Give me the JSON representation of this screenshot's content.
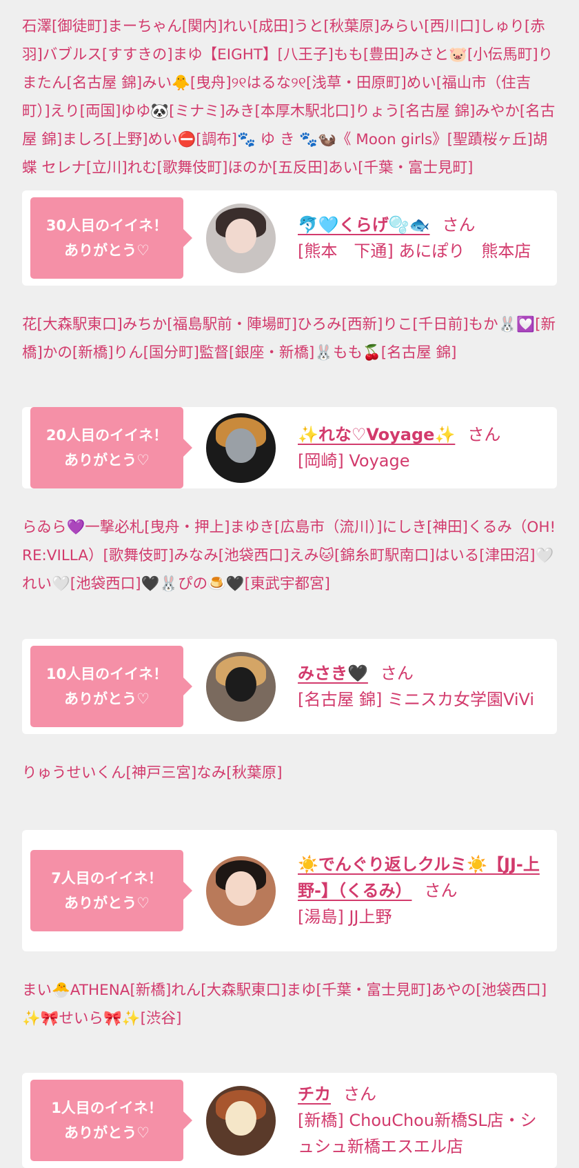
{
  "blocks": [
    {
      "kind": "names",
      "text": "石澤[御徒町]まーちゃん[関内]れい[成田]うと[秋葉原]みらい[西川口]しゅり[赤羽]バブルス[すすきの]まゆ【EIGHT】[八王子]もも[豊田]みさと🐷[小伝馬町]りまたん[名古屋 錦]みい🐥[曳舟]୨୧はるな୨୧[浅草・田原町]めい[福山市（住吉町）]えり[両国]ゆゆ🐼[ミナミ]みき[本厚木駅北口]りょう[名古屋 錦]みやか[名古屋 錦]ましろ[上野]めい⛔[調布]🐾 ゆ き 🐾🦦《 Moon girls》[聖蹟桜ヶ丘]胡蝶 セレナ[立川]れむ[歌舞伎町]ほのか[五反田]あい[千葉・富士見町]",
      "height": 236
    },
    {
      "kind": "card",
      "height": 138,
      "badge": [
        "30人目のイイネ！",
        "ありがとう♡"
      ],
      "name": "🐬🩵くらげ🫧🐟",
      "san": "さん",
      "shop": "[熊本　下通] あにぽり　熊本店",
      "avatar": {
        "bg": "#c9c4c2",
        "hair": "#3a2e2c",
        "face": "#f1d9cf"
      }
    },
    {
      "kind": "names",
      "text": "花[大森駅東口]みちか[福島駅前・陣場町]ひろみ[西新]りこ[千日前]もか🐰💟[新橋]かの[新橋]りん[国分町]監督[銀座・新橋]🐰もも🍒[名古屋 錦]",
      "height": 118
    },
    {
      "kind": "card",
      "height": 118,
      "badge": [
        "20人目のイイネ！",
        "ありがとう♡"
      ],
      "name": "✨れな♡Voyage✨",
      "san": "さん",
      "shop": "[岡崎] Voyage",
      "avatar": {
        "bg": "#1a1a1a",
        "hair": "#c98a3c",
        "face": "#9aa0a6"
      }
    },
    {
      "kind": "names",
      "text": "らゐら💜一撃必札[曳舟・押上]まゆき[広島市（流川）]にしき[神田]くるみ（OH!RE:VILLA）[歌舞伎町]みなみ[池袋西口]えみ🐱[錦糸町駅南口]はいる[津田沼]🤍れい🤍[池袋西口]🖤🐰ぴの🍮🖤[東武宇都宮]",
      "height": 160
    },
    {
      "kind": "card",
      "height": 138,
      "badge": [
        "10人目のイイネ！",
        "ありがとう♡"
      ],
      "name": "みさき🖤",
      "san": "さん",
      "shop": "[名古屋 錦] ミニスカ女学園ViVi",
      "avatar": {
        "bg": "#7a6a5e",
        "hair": "#d4a566",
        "face": "#1c1c1c"
      }
    },
    {
      "kind": "names",
      "text": "りゅうせいくん[神戸三宮]なみ[秋葉原]",
      "height": 81
    },
    {
      "kind": "card",
      "height": 176,
      "badge": [
        "7人目のイイネ！",
        "ありがとう♡"
      ],
      "name": "☀️でんぐり返しクルミ☀️【JJ-上野-】（くるみ）",
      "san": "さん",
      "shop": "[湯島] JJ上野",
      "avatar": {
        "bg": "#b97a5a",
        "hair": "#1e1714",
        "face": "#f4d8c8"
      }
    },
    {
      "kind": "names",
      "text": "まい🐣ATHENA[新橋]れん[大森駅東口]まゆ[千葉・富士見町]あやの[池袋西口]✨🎀せいら🎀✨[渋谷]",
      "height": 118
    },
    {
      "kind": "card",
      "height": 138,
      "badge": [
        "1人目のイイネ！",
        "ありがとう♡"
      ],
      "name": "チカ",
      "san": "さん",
      "shop": "[新橋] ChouChou新橋SL店・シュシュ新橋エスエル店",
      "avatar": {
        "bg": "#5a3a2a",
        "hair": "#a8562e",
        "face": "#f5e6c8"
      }
    }
  ]
}
